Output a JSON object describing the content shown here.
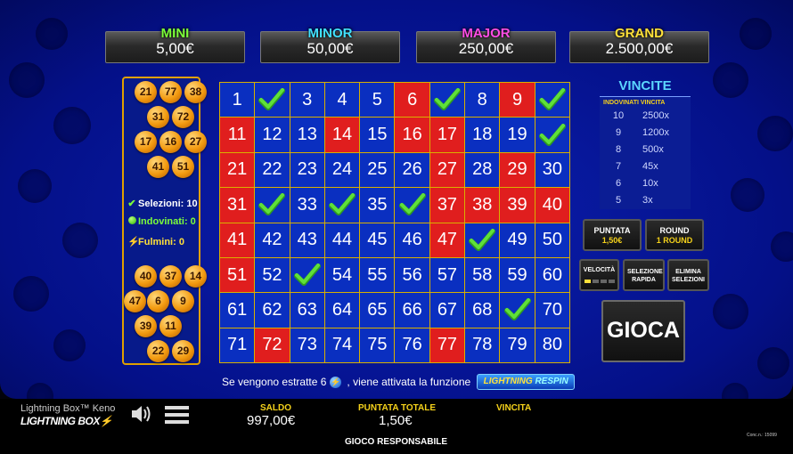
{
  "jackpots": [
    {
      "name": "MINI",
      "value": "5,00€",
      "color": "#7cff3a"
    },
    {
      "name": "MINOR",
      "value": "50,00€",
      "color": "#41e0ff"
    },
    {
      "name": "MAJOR",
      "value": "250,00€",
      "color": "#ff4de6"
    },
    {
      "name": "GRAND",
      "value": "2.500,00€",
      "color": "#ffe13a"
    }
  ],
  "drawn_top": [
    "21",
    "77",
    "38",
    "31",
    "72",
    "17",
    "16",
    "27",
    "41",
    "51"
  ],
  "drawn_bottom": [
    "40",
    "37",
    "14",
    "47",
    "6",
    "9",
    "39",
    "11",
    "22",
    "29"
  ],
  "stats": {
    "selezioni": "Selezioni: 10",
    "indovinati": "Indovinati: 0",
    "fulmini": "Fulmini: 0"
  },
  "board": {
    "numbers": [
      "1",
      "2",
      "3",
      "4",
      "5",
      "6",
      "7",
      "8",
      "9",
      "10",
      "11",
      "12",
      "13",
      "14",
      "15",
      "16",
      "17",
      "18",
      "19",
      "20",
      "21",
      "22",
      "23",
      "24",
      "25",
      "26",
      "27",
      "28",
      "29",
      "30",
      "31",
      "32",
      "33",
      "34",
      "35",
      "36",
      "37",
      "38",
      "39",
      "40",
      "41",
      "42",
      "43",
      "44",
      "45",
      "46",
      "47",
      "48",
      "49",
      "50",
      "51",
      "52",
      "53",
      "54",
      "55",
      "56",
      "57",
      "58",
      "59",
      "60",
      "61",
      "62",
      "63",
      "64",
      "65",
      "66",
      "67",
      "68",
      "69",
      "70",
      "71",
      "72",
      "73",
      "74",
      "75",
      "76",
      "77",
      "78",
      "79",
      "80"
    ],
    "red": [
      6,
      9,
      11,
      14,
      16,
      17,
      21,
      27,
      29,
      31,
      37,
      38,
      39,
      40,
      41,
      47,
      51,
      72,
      77
    ],
    "checked": [
      2,
      7,
      10,
      20,
      32,
      34,
      36,
      48,
      53,
      69
    ]
  },
  "vincite": {
    "title": "VINCITE",
    "header": "INDOVINATI VINCITA",
    "rows": [
      [
        "10",
        "2500x"
      ],
      [
        "9",
        "1200x"
      ],
      [
        "8",
        "500x"
      ],
      [
        "7",
        "45x"
      ],
      [
        "6",
        "10x"
      ],
      [
        "5",
        "3x"
      ]
    ]
  },
  "controls": {
    "puntata_label": "PUNTATA",
    "puntata_value": "1,50€",
    "round_label": "ROUND",
    "round_value": "1 ROUND",
    "velocita": "VELOCITÀ",
    "selezione_rapida": "SELEZIONE RAPIDA",
    "elimina_selezioni": "ELIMINA SELEZIONI",
    "velocita_level": 1,
    "gioca": "GIOCA"
  },
  "banner": {
    "text1": "Se vengono estratte 6",
    "text2": ", viene attivata la funzione",
    "logo_top": "LIGHTNING",
    "logo_bottom": "RESPIN"
  },
  "footer": {
    "game_title": "Lightning Box™ Keno",
    "brand": "LIGHTNING BOX",
    "saldo_label": "SALDO",
    "saldo_value": "997,00€",
    "puntata_totale_label": "PUNTATA TOTALE",
    "puntata_totale_value": "1,50€",
    "vincita_label": "VINCITA",
    "responsabile": "GIOCO RESPONSABILE",
    "conc": "Conc.n.: 15099"
  }
}
